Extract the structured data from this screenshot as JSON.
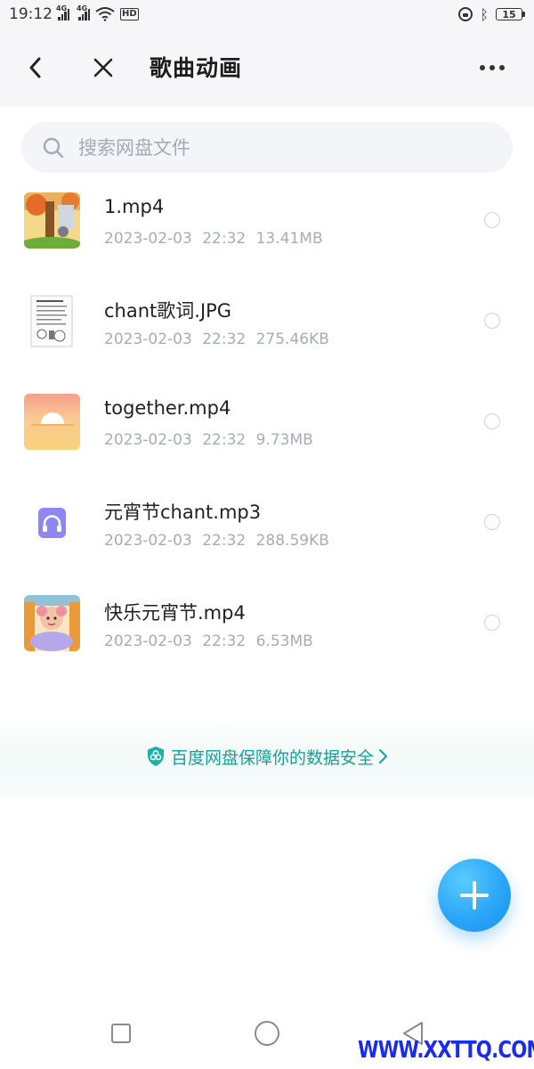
{
  "status_bar": {
    "time": "19:12",
    "network_1": "4G",
    "network_2": "4G",
    "hd_badge": "HD",
    "battery": "15",
    "icons": [
      "signal-4g-icon",
      "signal-4g-icon",
      "wifi-icon",
      "hd-icon",
      "lock-rotation-icon",
      "bluetooth-icon",
      "battery-icon"
    ]
  },
  "header": {
    "title": "歌曲动画",
    "back_icon": "chevron-left-icon",
    "close_icon": "close-icon",
    "more_icon": "more-horizontal-icon"
  },
  "search": {
    "placeholder": "搜索网盘文件",
    "value": ""
  },
  "files": [
    {
      "name": "1.mp4",
      "date": "2023-02-03",
      "time": "22:32",
      "size": "13.41MB",
      "thumb": "video-thumb-tree-cartoon"
    },
    {
      "name": "chant歌词.JPG",
      "date": "2023-02-03",
      "time": "22:32",
      "size": "275.46KB",
      "thumb": "image-thumb-lyrics-sheet"
    },
    {
      "name": "together.mp4",
      "date": "2023-02-03",
      "time": "22:32",
      "size": "9.73MB",
      "thumb": "video-thumb-sunset"
    },
    {
      "name": "元宵节chant.mp3",
      "date": "2023-02-03",
      "time": "22:32",
      "size": "288.59KB",
      "thumb": "audio-headphones-icon"
    },
    {
      "name": "快乐元宵节.mp4",
      "date": "2023-02-03",
      "time": "22:32",
      "size": "6.53MB",
      "thumb": "video-thumb-girl-cartoon"
    }
  ],
  "banner": {
    "text": "百度网盘保障你的数据安全",
    "icon": "shield-icon"
  },
  "fab": {
    "icon": "plus-icon"
  },
  "nav_bar": {
    "icons": [
      "recent-apps-icon",
      "home-icon",
      "back-triangle-icon"
    ]
  },
  "watermark": "WWW.XXTTQ.COM",
  "colors": {
    "accent": "#2aa6f7",
    "banner_text": "#12a29a",
    "meta_text": "#a6acb8",
    "header_bg": "#f6f6f8"
  }
}
